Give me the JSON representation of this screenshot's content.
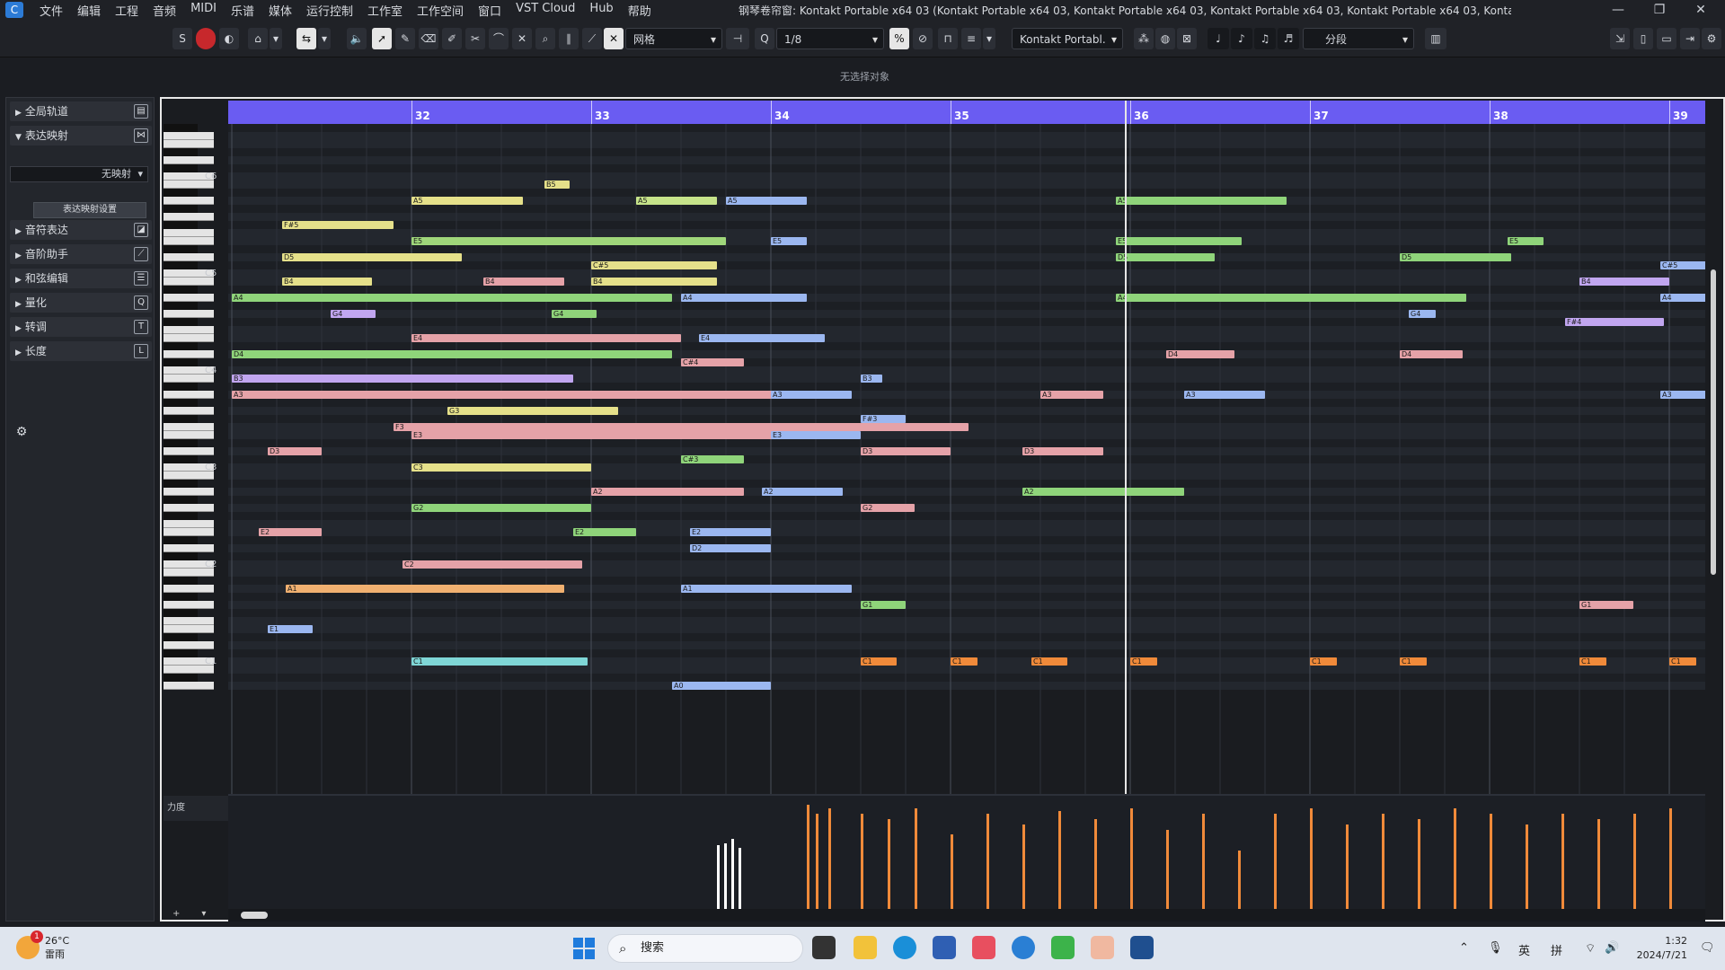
{
  "app": {
    "menu": [
      "文件",
      "编辑",
      "工程",
      "音频",
      "MIDI",
      "乐谱",
      "媒体",
      "运行控制",
      "工作室",
      "工作空间",
      "窗口",
      "VST Cloud",
      "Hub",
      "帮助"
    ],
    "window_title": "钢琴卷帘窗: Kontakt Portable x64 03 (Kontakt Portable x64 03, Kontakt Portable x64 03, Kontakt Portable x64 03, Kontakt Portable x64 03, Kontakt Portable x64 03 ...)"
  },
  "toolbar": {
    "solo": "S",
    "grid_type": "网格",
    "quantize": "1/8",
    "instrument": "Kontakt Portabl.",
    "segment": "分段"
  },
  "status_line": "无选择对象",
  "inspector": {
    "sections": [
      {
        "label": "全局轨道",
        "expanded": false
      },
      {
        "label": "表达映射",
        "expanded": true
      },
      {
        "label": "音符表达",
        "expanded": false
      },
      {
        "label": "音阶助手",
        "expanded": false
      },
      {
        "label": "和弦编辑",
        "expanded": false
      },
      {
        "label": "量化",
        "expanded": false
      },
      {
        "label": "转调",
        "expanded": false
      },
      {
        "label": "长度",
        "expanded": false
      }
    ],
    "expression_map_value": "无映射",
    "expression_map_settings": "表达映射设置"
  },
  "editor": {
    "bars": [
      "32",
      "33",
      "34",
      "35",
      "36",
      "37",
      "38",
      "39"
    ],
    "octaves": [
      "C6",
      "C5",
      "C4",
      "C3",
      "C2",
      "C1"
    ],
    "velocity_label": "力度"
  },
  "notes": [
    {
      "p": "B5",
      "b": 32.74,
      "l": 0.14,
      "c": "#e5e08a"
    },
    {
      "p": "A5",
      "b": 32.0,
      "l": 0.62,
      "c": "#e5e08a"
    },
    {
      "p": "A5",
      "b": 33.25,
      "l": 0.45,
      "c": "#c6e38a"
    },
    {
      "p": "A5",
      "b": 33.75,
      "l": 0.45,
      "c": "#9bb7f0"
    },
    {
      "p": "A5",
      "b": 35.92,
      "l": 0.95,
      "c": "#8fd47a"
    },
    {
      "p": "F#5",
      "b": 31.28,
      "l": 0.62,
      "c": "#e5e08a"
    },
    {
      "p": "E5",
      "b": 32.0,
      "l": 1.75,
      "c": "#9fd67a"
    },
    {
      "p": "E5",
      "b": 34.0,
      "l": 0.2,
      "c": "#9bb7f0"
    },
    {
      "p": "E5",
      "b": 35.92,
      "l": 0.7,
      "c": "#8fd47a"
    },
    {
      "p": "E5",
      "b": 38.1,
      "l": 0.2,
      "c": "#8fd47a"
    },
    {
      "p": "D5",
      "b": 31.28,
      "l": 1.0,
      "c": "#e5e08a"
    },
    {
      "p": "D5",
      "b": 35.92,
      "l": 0.55,
      "c": "#8fd47a"
    },
    {
      "p": "D5",
      "b": 37.5,
      "l": 0.62,
      "c": "#8fd47a"
    },
    {
      "p": "C#5",
      "b": 33.0,
      "l": 0.7,
      "c": "#e5e08a"
    },
    {
      "p": "C#5",
      "b": 38.95,
      "l": 0.3,
      "c": "#9bb7f0"
    },
    {
      "p": "B4",
      "b": 31.28,
      "l": 0.5,
      "c": "#e5e08a"
    },
    {
      "p": "B4",
      "b": 33.0,
      "l": 0.7,
      "c": "#e5e08a"
    },
    {
      "p": "B4",
      "b": 32.4,
      "l": 0.45,
      "c": "#e5a2a8"
    },
    {
      "p": "B4",
      "b": 38.5,
      "l": 0.5,
      "c": "#c1a6f0"
    },
    {
      "p": "A4",
      "b": 31.0,
      "l": 2.45,
      "c": "#8fd47a"
    },
    {
      "p": "A4",
      "b": 33.5,
      "l": 0.7,
      "c": "#9bb7f0"
    },
    {
      "p": "A4",
      "b": 35.92,
      "l": 1.95,
      "c": "#8fd47a"
    },
    {
      "p": "A4",
      "b": 38.95,
      "l": 0.3,
      "c": "#9bb7f0"
    },
    {
      "p": "G4",
      "b": 31.55,
      "l": 0.25,
      "c": "#c1a6f0"
    },
    {
      "p": "G4",
      "b": 32.78,
      "l": 0.25,
      "c": "#8fd47a"
    },
    {
      "p": "G4",
      "b": 37.55,
      "l": 0.15,
      "c": "#9bb7f0"
    },
    {
      "p": "F#4",
      "b": 38.42,
      "l": 0.55,
      "c": "#c1a6f0"
    },
    {
      "p": "E4",
      "b": 32.0,
      "l": 1.5,
      "c": "#e5a2a8"
    },
    {
      "p": "E4",
      "b": 33.6,
      "l": 0.7,
      "c": "#9bb7f0"
    },
    {
      "p": "D4",
      "b": 31.0,
      "l": 2.45,
      "c": "#8fd47a"
    },
    {
      "p": "D4",
      "b": 36.2,
      "l": 0.38,
      "c": "#e5a2a8"
    },
    {
      "p": "D4",
      "b": 37.5,
      "l": 0.35,
      "c": "#e5a2a8"
    },
    {
      "p": "C#4",
      "b": 33.5,
      "l": 0.35,
      "c": "#e5a2a8"
    },
    {
      "p": "B3",
      "b": 31.0,
      "l": 1.9,
      "c": "#c1a6f0"
    },
    {
      "p": "B3",
      "b": 34.5,
      "l": 0.12,
      "c": "#9bb7f0"
    },
    {
      "p": "A3",
      "b": 31.0,
      "l": 3.3,
      "c": "#e5a2a8"
    },
    {
      "p": "A3",
      "b": 34.0,
      "l": 0.45,
      "c": "#9bb7f0"
    },
    {
      "p": "A3",
      "b": 35.5,
      "l": 0.35,
      "c": "#e5a2a8"
    },
    {
      "p": "A3",
      "b": 36.3,
      "l": 0.45,
      "c": "#9bb7f0"
    },
    {
      "p": "A3",
      "b": 38.95,
      "l": 0.3,
      "c": "#9bb7f0"
    },
    {
      "p": "G3",
      "b": 32.2,
      "l": 0.95,
      "c": "#e5e08a"
    },
    {
      "p": "F#3",
      "b": 34.5,
      "l": 0.25,
      "c": "#9bb7f0"
    },
    {
      "p": "F3",
      "b": 31.9,
      "l": 3.2,
      "c": "#e5a2a8"
    },
    {
      "p": "E3",
      "b": 32.0,
      "l": 2.4,
      "c": "#e5a2a8"
    },
    {
      "p": "E3",
      "b": 34.0,
      "l": 0.5,
      "c": "#9bb7f0"
    },
    {
      "p": "D3",
      "b": 31.2,
      "l": 0.3,
      "c": "#e5a2a8"
    },
    {
      "p": "D3",
      "b": 34.5,
      "l": 0.5,
      "c": "#e5a2a8"
    },
    {
      "p": "D3",
      "b": 35.4,
      "l": 0.45,
      "c": "#e5a2a8"
    },
    {
      "p": "C#3",
      "b": 33.5,
      "l": 0.35,
      "c": "#8fd47a"
    },
    {
      "p": "C3",
      "b": 32.0,
      "l": 1.0,
      "c": "#e5e08a"
    },
    {
      "p": "A2",
      "b": 33.0,
      "l": 0.85,
      "c": "#e5a2a8"
    },
    {
      "p": "A2",
      "b": 33.95,
      "l": 0.45,
      "c": "#9bb7f0"
    },
    {
      "p": "A2",
      "b": 35.4,
      "l": 0.9,
      "c": "#8fd47a"
    },
    {
      "p": "G2",
      "b": 32.0,
      "l": 1.0,
      "c": "#8fd47a"
    },
    {
      "p": "G2",
      "b": 34.5,
      "l": 0.3,
      "c": "#e5a2a8"
    },
    {
      "p": "E2",
      "b": 31.15,
      "l": 0.35,
      "c": "#e5a2a8"
    },
    {
      "p": "E2",
      "b": 32.9,
      "l": 0.35,
      "c": "#8fd47a"
    },
    {
      "p": "E2",
      "b": 33.55,
      "l": 0.45,
      "c": "#9bb7f0"
    },
    {
      "p": "D2",
      "b": 33.55,
      "l": 0.45,
      "c": "#9bb7f0"
    },
    {
      "p": "C2",
      "b": 31.95,
      "l": 1.0,
      "c": "#e5a2a8"
    },
    {
      "p": "A1",
      "b": 31.3,
      "l": 1.55,
      "c": "#f0b070"
    },
    {
      "p": "A1",
      "b": 33.5,
      "l": 0.95,
      "c": "#9bb7f0"
    },
    {
      "p": "G1",
      "b": 34.5,
      "l": 0.25,
      "c": "#8fd47a"
    },
    {
      "p": "G1",
      "b": 38.5,
      "l": 0.3,
      "c": "#e5a2a8"
    },
    {
      "p": "E1",
      "b": 31.2,
      "l": 0.25,
      "c": "#9bb7f0"
    },
    {
      "p": "C1",
      "b": 32.0,
      "l": 0.98,
      "c": "#7fd6d6"
    },
    {
      "p": "C1",
      "b": 34.5,
      "l": 0.2,
      "c": "#f08a3a"
    },
    {
      "p": "C1",
      "b": 35.0,
      "l": 0.15,
      "c": "#f08a3a"
    },
    {
      "p": "C1",
      "b": 35.45,
      "l": 0.2,
      "c": "#f08a3a"
    },
    {
      "p": "C1",
      "b": 36.0,
      "l": 0.15,
      "c": "#f08a3a"
    },
    {
      "p": "C1",
      "b": 37.0,
      "l": 0.15,
      "c": "#f08a3a"
    },
    {
      "p": "C1",
      "b": 37.5,
      "l": 0.15,
      "c": "#f08a3a"
    },
    {
      "p": "C1",
      "b": 38.5,
      "l": 0.15,
      "c": "#f08a3a"
    },
    {
      "p": "C1",
      "b": 39.0,
      "l": 0.15,
      "c": "#f08a3a"
    },
    {
      "p": "A0",
      "b": 33.45,
      "l": 0.55,
      "c": "#9bb7f0"
    }
  ],
  "velocities": [
    {
      "b": 33.7,
      "v": 0.6,
      "c": "#ffffff"
    },
    {
      "b": 33.74,
      "v": 0.62,
      "c": "#ffffff"
    },
    {
      "b": 33.78,
      "v": 0.66,
      "c": "#ffffff"
    },
    {
      "b": 33.82,
      "v": 0.58,
      "c": "#ffffff"
    },
    {
      "b": 34.2,
      "v": 0.98,
      "c": "#f08a3a"
    },
    {
      "b": 34.25,
      "v": 0.9,
      "c": "#f08a3a"
    },
    {
      "b": 34.32,
      "v": 0.95,
      "c": "#f08a3a"
    },
    {
      "b": 34.5,
      "v": 0.9,
      "c": "#f08a3a"
    },
    {
      "b": 34.65,
      "v": 0.85,
      "c": "#f08a3a"
    },
    {
      "b": 34.8,
      "v": 0.95,
      "c": "#f08a3a"
    },
    {
      "b": 35.0,
      "v": 0.7,
      "c": "#f08a3a"
    },
    {
      "b": 35.2,
      "v": 0.9,
      "c": "#f08a3a"
    },
    {
      "b": 35.4,
      "v": 0.8,
      "c": "#f08a3a"
    },
    {
      "b": 35.6,
      "v": 0.92,
      "c": "#f08a3a"
    },
    {
      "b": 35.8,
      "v": 0.85,
      "c": "#f08a3a"
    },
    {
      "b": 36.0,
      "v": 0.95,
      "c": "#f08a3a"
    },
    {
      "b": 36.2,
      "v": 0.75,
      "c": "#f08a3a"
    },
    {
      "b": 36.4,
      "v": 0.9,
      "c": "#f08a3a"
    },
    {
      "b": 36.6,
      "v": 0.55,
      "c": "#f08a3a"
    },
    {
      "b": 36.8,
      "v": 0.9,
      "c": "#f08a3a"
    },
    {
      "b": 37.0,
      "v": 0.95,
      "c": "#f08a3a"
    },
    {
      "b": 37.2,
      "v": 0.8,
      "c": "#f08a3a"
    },
    {
      "b": 37.4,
      "v": 0.9,
      "c": "#f08a3a"
    },
    {
      "b": 37.6,
      "v": 0.85,
      "c": "#f08a3a"
    },
    {
      "b": 37.8,
      "v": 0.95,
      "c": "#f08a3a"
    },
    {
      "b": 38.0,
      "v": 0.9,
      "c": "#f08a3a"
    },
    {
      "b": 38.2,
      "v": 0.8,
      "c": "#f08a3a"
    },
    {
      "b": 38.4,
      "v": 0.9,
      "c": "#f08a3a"
    },
    {
      "b": 38.6,
      "v": 0.85,
      "c": "#f08a3a"
    },
    {
      "b": 38.8,
      "v": 0.9,
      "c": "#f08a3a"
    },
    {
      "b": 39.0,
      "v": 0.95,
      "c": "#f08a3a"
    }
  ],
  "taskbar": {
    "weather_temp": "26°C",
    "weather_desc": "雷雨",
    "weather_badge": "1",
    "search_placeholder": "搜索",
    "ime_lang": "英",
    "ime_mode": "拼",
    "time": "1:32",
    "date": "2024/7/21"
  }
}
